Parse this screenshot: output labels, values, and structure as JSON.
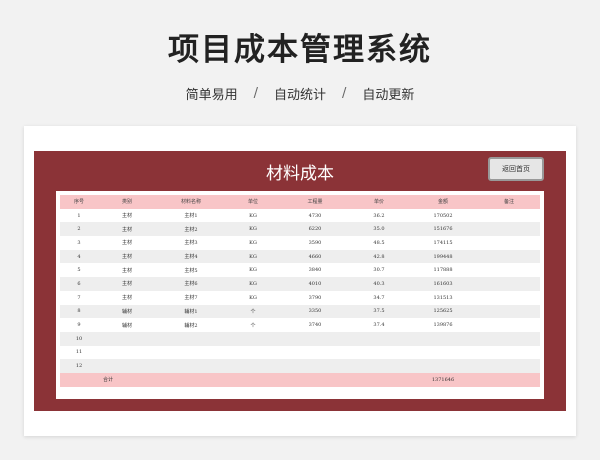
{
  "page": {
    "title": "项目成本管理系统",
    "features": [
      "简单易用",
      "自动统计",
      "自动更新"
    ],
    "separator": "/"
  },
  "panel": {
    "title": "材料成本",
    "home_button": "返回首页"
  },
  "table": {
    "headers": [
      "序号",
      "类别",
      "材料名称",
      "单位",
      "工程量",
      "单价",
      "金额",
      "备注"
    ],
    "rows": [
      [
        "1",
        "主材",
        "主材1",
        "KG",
        "4730",
        "36.2",
        "170502",
        ""
      ],
      [
        "2",
        "主材",
        "主材2",
        "KG",
        "6220",
        "35.0",
        "151676",
        ""
      ],
      [
        "3",
        "主材",
        "主材3",
        "KG",
        "3590",
        "48.5",
        "174115",
        ""
      ],
      [
        "4",
        "主材",
        "主材4",
        "KG",
        "4660",
        "42.8",
        "199448",
        ""
      ],
      [
        "5",
        "主材",
        "主材5",
        "KG",
        "3840",
        "30.7",
        "117888",
        ""
      ],
      [
        "6",
        "主材",
        "主材6",
        "KG",
        "4010",
        "40.3",
        "161603",
        ""
      ],
      [
        "7",
        "主材",
        "主材7",
        "KG",
        "3790",
        "34.7",
        "131513",
        ""
      ],
      [
        "8",
        "辅材",
        "辅材1",
        "个",
        "3350",
        "37.5",
        "125625",
        ""
      ],
      [
        "9",
        "辅材",
        "辅材2",
        "个",
        "3740",
        "37.4",
        "139876",
        ""
      ],
      [
        "10",
        "",
        "",
        "",
        "",
        "",
        "",
        ""
      ],
      [
        "11",
        "",
        "",
        "",
        "",
        "",
        "",
        ""
      ],
      [
        "12",
        "",
        "",
        "",
        "",
        "",
        "",
        ""
      ]
    ],
    "total_label": "合计",
    "total_amount": "1371646"
  },
  "colors": {
    "panel_bg": "#8b3337",
    "header_bg": "#f8c5c7",
    "row_alt": "#eeeeee"
  }
}
